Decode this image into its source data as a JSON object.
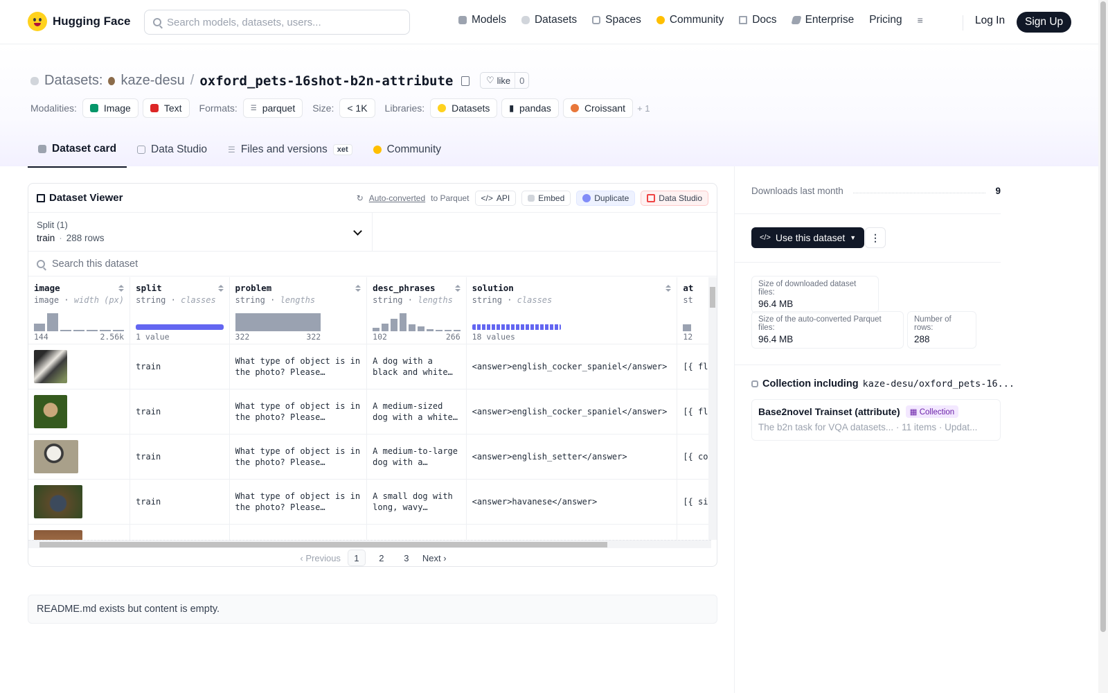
{
  "nav": {
    "brand": "Hugging Face",
    "search_placeholder": "Search models, datasets, users...",
    "items": [
      "Models",
      "Datasets",
      "Spaces",
      "Community",
      "Docs",
      "Enterprise",
      "Pricing"
    ],
    "login": "Log In",
    "signup": "Sign Up"
  },
  "header": {
    "section": "Datasets:",
    "owner": "kaze-desu",
    "sep": "/",
    "name": "oxford_pets-16shot-b2n-attribute",
    "like_label": "like",
    "like_count": "0",
    "modalities_label": "Modalities:",
    "modalities": [
      "Image",
      "Text"
    ],
    "formats_label": "Formats:",
    "format": "parquet",
    "size_label": "Size:",
    "size": "< 1K",
    "libraries_label": "Libraries:",
    "libraries": [
      "Datasets",
      "pandas",
      "Croissant"
    ],
    "more_libraries": "+ 1"
  },
  "tabs": [
    "Dataset card",
    "Data Studio",
    "Files and versions",
    "Community"
  ],
  "xet_badge": "xet",
  "viewer": {
    "title": "Dataset Viewer",
    "auto_converted": "Auto-converted",
    "to_parquet": "to Parquet",
    "buttons": [
      "API",
      "Embed",
      "Duplicate",
      "Data Studio"
    ],
    "split_label": "Split (1)",
    "split_value": "train",
    "split_rows": "288 rows",
    "search_placeholder": "Search this dataset",
    "columns": [
      {
        "name": "image",
        "type": "image",
        "stat": "width (px)",
        "min": "144",
        "max": "2.56k"
      },
      {
        "name": "split",
        "type": "string",
        "stat": "classes",
        "summary": "1 value"
      },
      {
        "name": "problem",
        "type": "string",
        "stat": "lengths",
        "min": "322",
        "max": "322"
      },
      {
        "name": "desc_phrases",
        "type": "string",
        "stat": "lengths",
        "min": "102",
        "max": "266"
      },
      {
        "name": "solution",
        "type": "string",
        "stat": "classes",
        "summary": "18 values"
      },
      {
        "name": "at",
        "type": "st",
        "stat": "",
        "min": "12"
      }
    ],
    "rows": [
      {
        "split": "train",
        "problem": "What type of object is in the photo? Please choose...",
        "desc": "A dog with a black and white coat,...",
        "solution": "<answer>english_cocker_spaniel</answer>",
        "extra": "[{ fl"
      },
      {
        "split": "train",
        "problem": "What type of object is in the photo? Please choose...",
        "desc": "A medium-sized dog with a white and...",
        "solution": "<answer>english_cocker_spaniel</answer>",
        "extra": "[{ fl"
      },
      {
        "split": "train",
        "problem": "What type of object is in the photo? Please choose...",
        "desc": "A medium-to-large dog with a white...",
        "solution": "<answer>english_setter</answer>",
        "extra": "[{ co"
      },
      {
        "split": "train",
        "problem": "What type of object is in the photo? Please choose...",
        "desc": "A small dog with long, wavy gray...",
        "solution": "<answer>havanese</answer>",
        "extra": "[{ si"
      }
    ],
    "pager": {
      "prev": "Previous",
      "pages": [
        "1",
        "2",
        "3"
      ],
      "current": "1",
      "next": "Next"
    }
  },
  "readme_note": "README.md exists but content is empty.",
  "sidebar": {
    "downloads_label": "Downloads last month",
    "downloads_value": "9",
    "use_button": "Use this dataset",
    "stats": [
      {
        "label": "Size of downloaded dataset files:",
        "value": "96.4 MB"
      },
      {
        "label": "Size of the auto-converted Parquet files:",
        "value": "96.4 MB"
      },
      {
        "label": "Number of rows:",
        "value": "288"
      }
    ],
    "collection_heading": "Collection including",
    "collection_target": "kaze-desu/oxford_pets-16...",
    "collection_title": "Base2novel Trainset (attribute)",
    "collection_badge": "Collection",
    "collection_desc": "The b2n task for VQA datasets...",
    "collection_items": "11 items",
    "collection_updated": "Updat..."
  },
  "colors": {
    "accent": "#6366f1",
    "brand": "#ffd21e",
    "dark": "#111827"
  }
}
